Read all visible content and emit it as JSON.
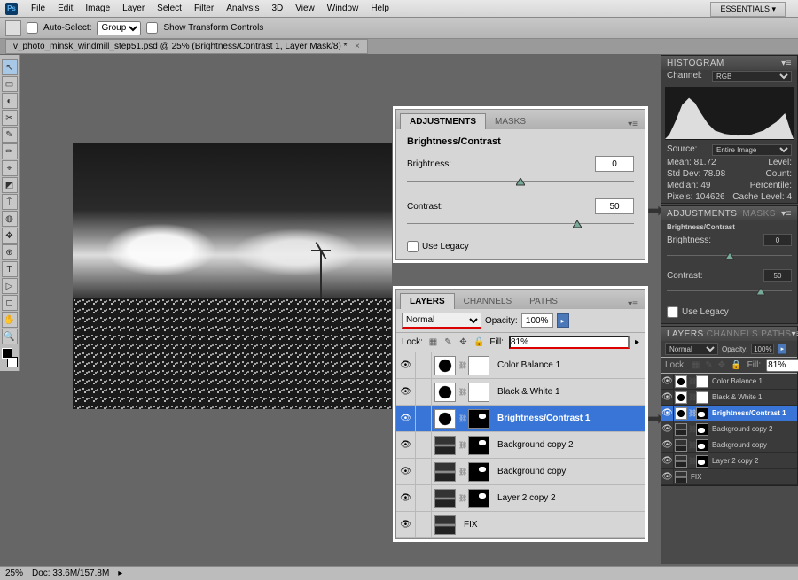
{
  "menubar": [
    "File",
    "Edit",
    "Image",
    "Layer",
    "Select",
    "Filter",
    "Analysis",
    "3D",
    "View",
    "Window",
    "Help"
  ],
  "workspace": "ESSENTIALS ▾",
  "optionsbar": {
    "autoSelect": "Auto-Select:",
    "group": "Group",
    "showTransform": "Show Transform Controls"
  },
  "docTab": "v_photo_minsk_windmill_step51.psd @ 25% (Brightness/Contrast 1, Layer Mask/8) *",
  "status": {
    "zoom": "25%",
    "doc": "Doc: 33.6M/157.8M"
  },
  "adjustments": {
    "tabAdjustments": "ADJUSTMENTS",
    "tabMasks": "MASKS",
    "title": "Brightness/Contrast",
    "brightnessLabel": "Brightness:",
    "brightnessValue": "0",
    "contrastLabel": "Contrast:",
    "contrastValue": "50",
    "useLegacy": "Use Legacy"
  },
  "layersPanel": {
    "tabLayers": "LAYERS",
    "tabChannels": "CHANNELS",
    "tabPaths": "PATHS",
    "blend": "Normal",
    "opacityLabel": "Opacity:",
    "opacity": "100%",
    "lockLabel": "Lock:",
    "fillLabel": "Fill:",
    "fill": "81%",
    "layers": [
      {
        "name": "Color Balance 1",
        "type": "adj",
        "mask": "mask"
      },
      {
        "name": "Black & White 1",
        "type": "adj",
        "mask": "mask"
      },
      {
        "name": "Brightness/Contrast 1",
        "type": "adj",
        "mask": "maskdark",
        "selected": true
      },
      {
        "name": "Background copy 2",
        "type": "img",
        "mask": "maskdark"
      },
      {
        "name": "Background copy",
        "type": "img",
        "mask": "maskdark"
      },
      {
        "name": "Layer 2 copy 2",
        "type": "img",
        "mask": "maskdark"
      },
      {
        "name": "FIX",
        "type": "img",
        "mask": ""
      }
    ]
  },
  "histogram": {
    "title": "HISTOGRAM",
    "channelLabel": "Channel:",
    "channel": "RGB",
    "sourceLabel": "Source:",
    "source": "Entire Image",
    "stats": {
      "mean": "Mean:",
      "meanV": "81.72",
      "stddev": "Std Dev:",
      "stddevV": "78.98",
      "median": "Median:",
      "medianV": "49",
      "pixels": "Pixels:",
      "pixelsV": "104626",
      "level": "Level:",
      "count": "Count:",
      "percentile": "Percentile:",
      "cache": "Cache Level:",
      "cacheV": "4"
    }
  },
  "tools": [
    "↖",
    "▭",
    "◐",
    "✂",
    "✎",
    "✏",
    "⌖",
    "◩",
    "⍑",
    "◍",
    "✥",
    "⊕",
    "T",
    "▷",
    "◻",
    "✋",
    "🔍"
  ]
}
